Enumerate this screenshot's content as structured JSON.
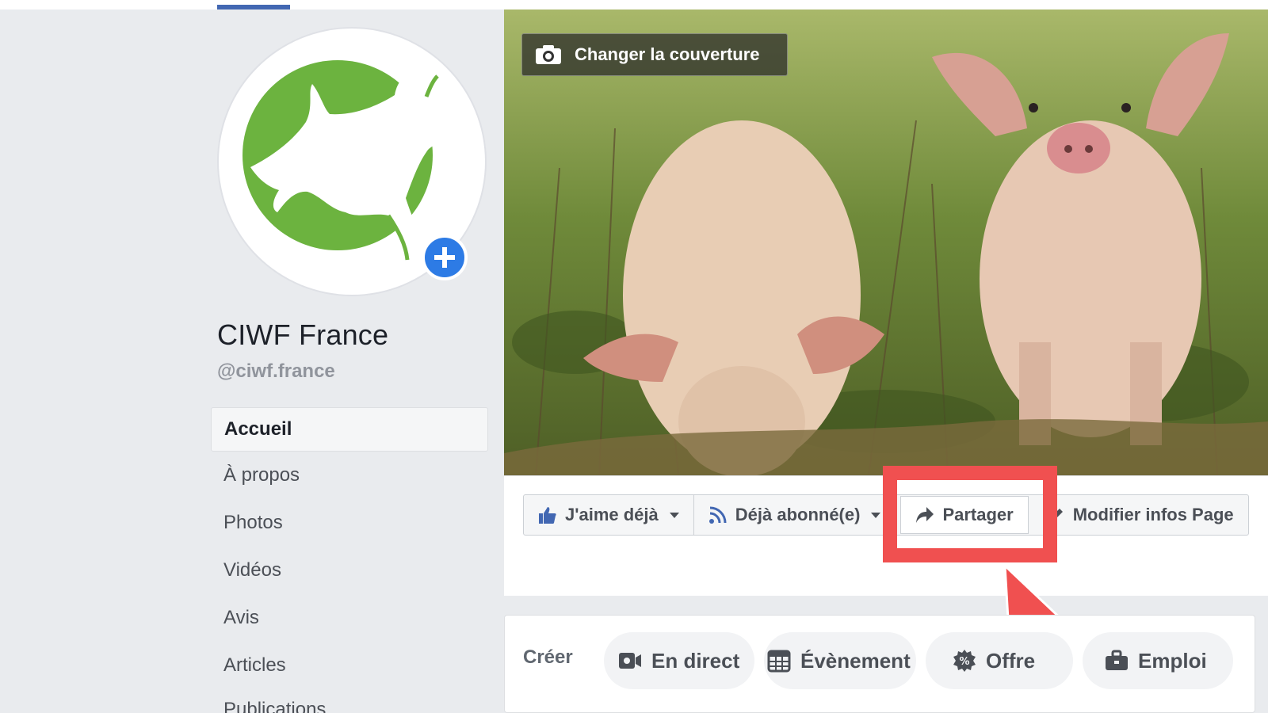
{
  "cover": {
    "change_cover_label": "Changer la couverture"
  },
  "profile": {
    "name": "CIWF France",
    "handle": "@ciwf.france"
  },
  "sidebar": {
    "items": [
      {
        "label": "Accueil",
        "active": true
      },
      {
        "label": "À propos"
      },
      {
        "label": "Photos"
      },
      {
        "label": "Vidéos"
      },
      {
        "label": "Avis"
      },
      {
        "label": "Articles"
      },
      {
        "label": "Publications"
      }
    ]
  },
  "actions": {
    "like": "J'aime déjà",
    "follow": "Déjà abonné(e)",
    "share": "Partager",
    "edit": "Modifier infos Page"
  },
  "create": {
    "label": "Créer",
    "live": "En direct",
    "event": "Évènement",
    "offer": "Offre",
    "job": "Emploi"
  },
  "colors": {
    "brand_blue": "#4267b2",
    "highlight_red": "#f05050",
    "logo_green": "#6cb33f"
  },
  "icons": {
    "camera": "camera-icon",
    "like": "thumbs-up-icon",
    "follow": "rss-icon",
    "share": "share-arrow-icon",
    "edit": "pencil-icon",
    "live": "video-camera-icon",
    "event": "calendar-icon",
    "offer": "percent-badge-icon",
    "job": "briefcase-icon"
  }
}
